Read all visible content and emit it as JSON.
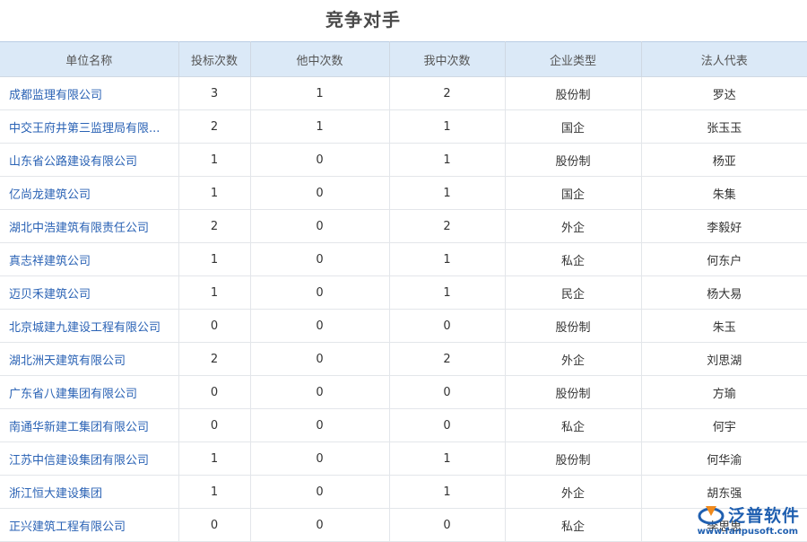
{
  "title": "竞争对手",
  "table": {
    "headers": [
      "单位名称",
      "投标次数",
      "他中次数",
      "我中次数",
      "企业类型",
      "法人代表"
    ],
    "rows": [
      [
        "成都监理有限公司",
        "3",
        "1",
        "2",
        "股份制",
        "罗达"
      ],
      [
        "中交王府井第三监理局有限...",
        "2",
        "1",
        "1",
        "国企",
        "张玉玉"
      ],
      [
        "山东省公路建设有限公司",
        "1",
        "0",
        "1",
        "股份制",
        "杨亚"
      ],
      [
        "亿尚龙建筑公司",
        "1",
        "0",
        "1",
        "国企",
        "朱集"
      ],
      [
        "湖北中浩建筑有限责任公司",
        "2",
        "0",
        "2",
        "外企",
        "李毅好"
      ],
      [
        "真志祥建筑公司",
        "1",
        "0",
        "1",
        "私企",
        "何东户"
      ],
      [
        "迈贝禾建筑公司",
        "1",
        "0",
        "1",
        "民企",
        "杨大易"
      ],
      [
        "北京城建九建设工程有限公司",
        "0",
        "0",
        "0",
        "股份制",
        "朱玉"
      ],
      [
        "湖北洲天建筑有限公司",
        "2",
        "0",
        "2",
        "外企",
        "刘思湖"
      ],
      [
        "广东省八建集团有限公司",
        "0",
        "0",
        "0",
        "股份制",
        "方瑜"
      ],
      [
        "南通华新建工集团有限公司",
        "0",
        "0",
        "0",
        "私企",
        "何宇"
      ],
      [
        "江苏中信建设集团有限公司",
        "1",
        "0",
        "1",
        "股份制",
        "何华渝"
      ],
      [
        "浙江恒大建设集团",
        "1",
        "0",
        "1",
        "外企",
        "胡东强"
      ],
      [
        "正兴建筑工程有限公司",
        "0",
        "0",
        "0",
        "私企",
        "李思思"
      ]
    ]
  },
  "watermark": {
    "brand": "泛普软件",
    "url": "www.fanpusoft.com",
    "colors": {
      "blue": "#1f5fb0",
      "orange": "#f08a1c"
    }
  }
}
